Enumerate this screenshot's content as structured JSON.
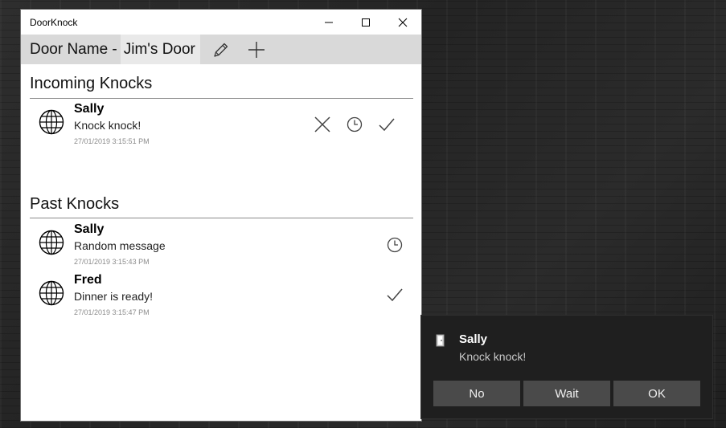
{
  "window": {
    "title": "DoorKnock"
  },
  "toolbar": {
    "door_label": "Door Name -",
    "door_name": "Jim's Door",
    "icons": [
      "pencil-icon",
      "plus-icon"
    ]
  },
  "incoming": {
    "heading": "Incoming Knocks",
    "items": [
      {
        "name": "Sally",
        "message": "Knock knock!",
        "time": "27/01/2019 3:15:51 PM",
        "actions": [
          "close-icon",
          "clock-icon",
          "check-icon"
        ]
      }
    ]
  },
  "past": {
    "heading": "Past Knocks",
    "items": [
      {
        "name": "Sally",
        "message": "Random message",
        "time": "27/01/2019 3:15:43 PM",
        "status_icon": "clock-icon"
      },
      {
        "name": "Fred",
        "message": "Dinner is ready!",
        "time": "27/01/2019 3:15:47 PM",
        "status_icon": "check-icon"
      }
    ]
  },
  "toast": {
    "title": "Sally",
    "message": "Knock knock!",
    "buttons": {
      "no": "No",
      "wait": "Wait",
      "ok": "OK"
    },
    "colors": {
      "background": "#1f1f1f",
      "button": "#4a4a4a"
    }
  }
}
